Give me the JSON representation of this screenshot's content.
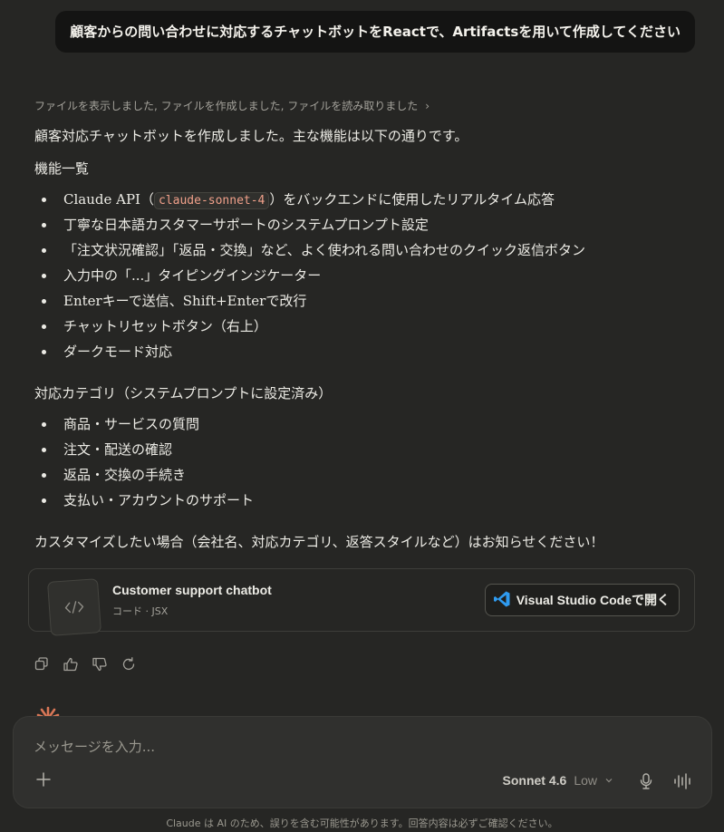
{
  "user_message": "顧客からの問い合わせに対応するチャットボットをReactで、Artifactsを用いて作成してください",
  "tool_summary": "ファイルを表示しました, ファイルを作成しました, ファイルを読み取りました",
  "response": {
    "intro": "顧客対応チャットボットを作成しました。主な機能は以下の通りです。",
    "features_heading": "機能一覧",
    "features": {
      "api_prefix": "Claude API（",
      "api_model": "claude-sonnet-4",
      "api_suffix": "）をバックエンドに使用したリアルタイム応答",
      "items": [
        "丁寧な日本語カスタマーサポートのシステムプロンプト設定",
        "「注文状況確認」「返品・交換」など、よく使われる問い合わせのクイック返信ボタン",
        "入力中の「...」タイピングインジケーター",
        "Enterキーで送信、Shift+Enterで改行",
        "チャットリセットボタン（右上）",
        "ダークモード対応"
      ]
    },
    "categories_heading": "対応カテゴリ（システムプロンプトに設定済み）",
    "categories": [
      "商品・サービスの質問",
      "注文・配送の確認",
      "返品・交換の手続き",
      "支払い・アカウントのサポート"
    ],
    "closing": "カスタマイズしたい場合（会社名、対応カテゴリ、返答スタイルなど）はお知らせください！"
  },
  "artifact": {
    "title": "Customer support chatbot",
    "subtitle": "コード · JSX",
    "open_button": "Visual Studio Codeで開く"
  },
  "composer": {
    "placeholder": "メッセージを入力...",
    "model": "Sonnet 4.6",
    "effort": "Low"
  },
  "disclaimer": "Claude は AI のため、誤りを含む可能性があります。回答内容は必ずご確認ください。",
  "colors": {
    "background": "#262624",
    "accent": "#d97757",
    "vscode_blue": "#2f9bf0"
  }
}
